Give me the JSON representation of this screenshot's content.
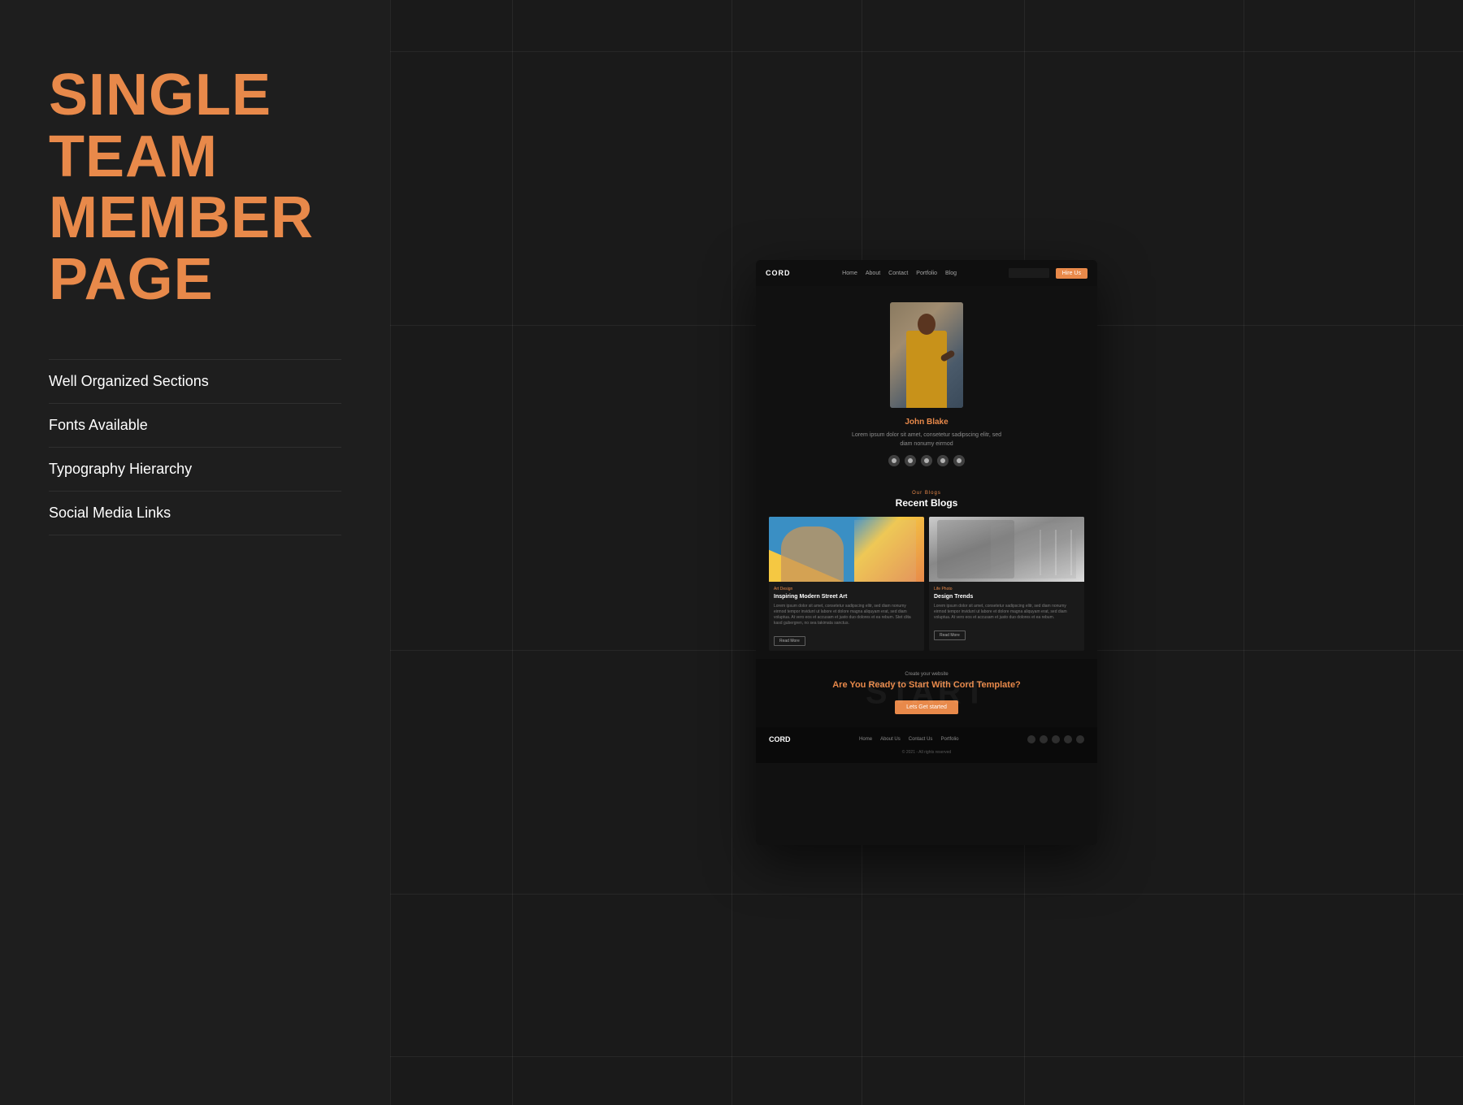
{
  "left_panel": {
    "title_line1": "SINGLE TEAM",
    "title_line2": "MEMBER",
    "title_line3": "PAGE",
    "features": [
      {
        "id": "feature-1",
        "label": "Well Organized Sections"
      },
      {
        "id": "feature-2",
        "label": "Fonts Available"
      },
      {
        "id": "feature-3",
        "label": "Typography Hierarchy"
      },
      {
        "id": "feature-4",
        "label": "Social Media Links"
      }
    ]
  },
  "mockup": {
    "nav": {
      "logo": "CORD",
      "links": [
        "Home",
        "About",
        "Contact",
        "Portfolio",
        "Blog"
      ],
      "cta_btn": "Hire Us"
    },
    "profile": {
      "name": "John Blake",
      "bio": "Lorem ipsum dolor sit amet, consetetur sadipscing elitr, sed diam nonumy eirmod",
      "social_icons": [
        "facebook",
        "twitter",
        "instagram",
        "pinterest",
        "youtube"
      ]
    },
    "recent_blogs": {
      "section_label": "Our Blogs",
      "section_title": "Recent Blogs",
      "blogs": [
        {
          "tag": "Art Design",
          "title": "Inspiring Modern Street Art",
          "excerpt": "Lorem ipsum dolor sit amet, consetetur sadipscing elitr, sed diam nonumy eirmod tempor invidunt ut labore et dolore magna aliquyam erat, sed diam voluptua. At vero eos et accusam et justo duo dolores et ea rebum. Stet clita kasd gubergren, no sea takimata sanctus.",
          "read_more": "Read More",
          "image_type": "colorful"
        },
        {
          "tag": "Life Photo",
          "title": "Design Trends",
          "excerpt": "Lorem ipsum dolor sit amet, consetetur sadipscing elitr, sed diam nonumy eirmod tempor invidunt ut labore et dolore magna aliquyam erat, sed diam voluptua. At vero eos et accusam et justo duo dolores et ea rebum.",
          "read_more": "Read More",
          "image_type": "bw"
        }
      ]
    },
    "cta": {
      "watermark": "START",
      "label": "Create your website",
      "heading_pre": "Are You ",
      "heading_highlight": "Ready",
      "heading_post": " to Start With Cord Template?",
      "btn_label": "Lets Get started"
    },
    "footer": {
      "logo": "CORD",
      "links": [
        "Home",
        "About Us",
        "Contact Us",
        "Portfolio"
      ],
      "copyright": "© 2021 - All rights reserved"
    }
  },
  "colors": {
    "accent": "#e8894a",
    "bg_dark": "#1a1a1a",
    "bg_panel": "#1e1e1e",
    "bg_mockup": "#111111",
    "text_white": "#ffffff",
    "text_muted": "rgba(255,255,255,0.5)"
  }
}
